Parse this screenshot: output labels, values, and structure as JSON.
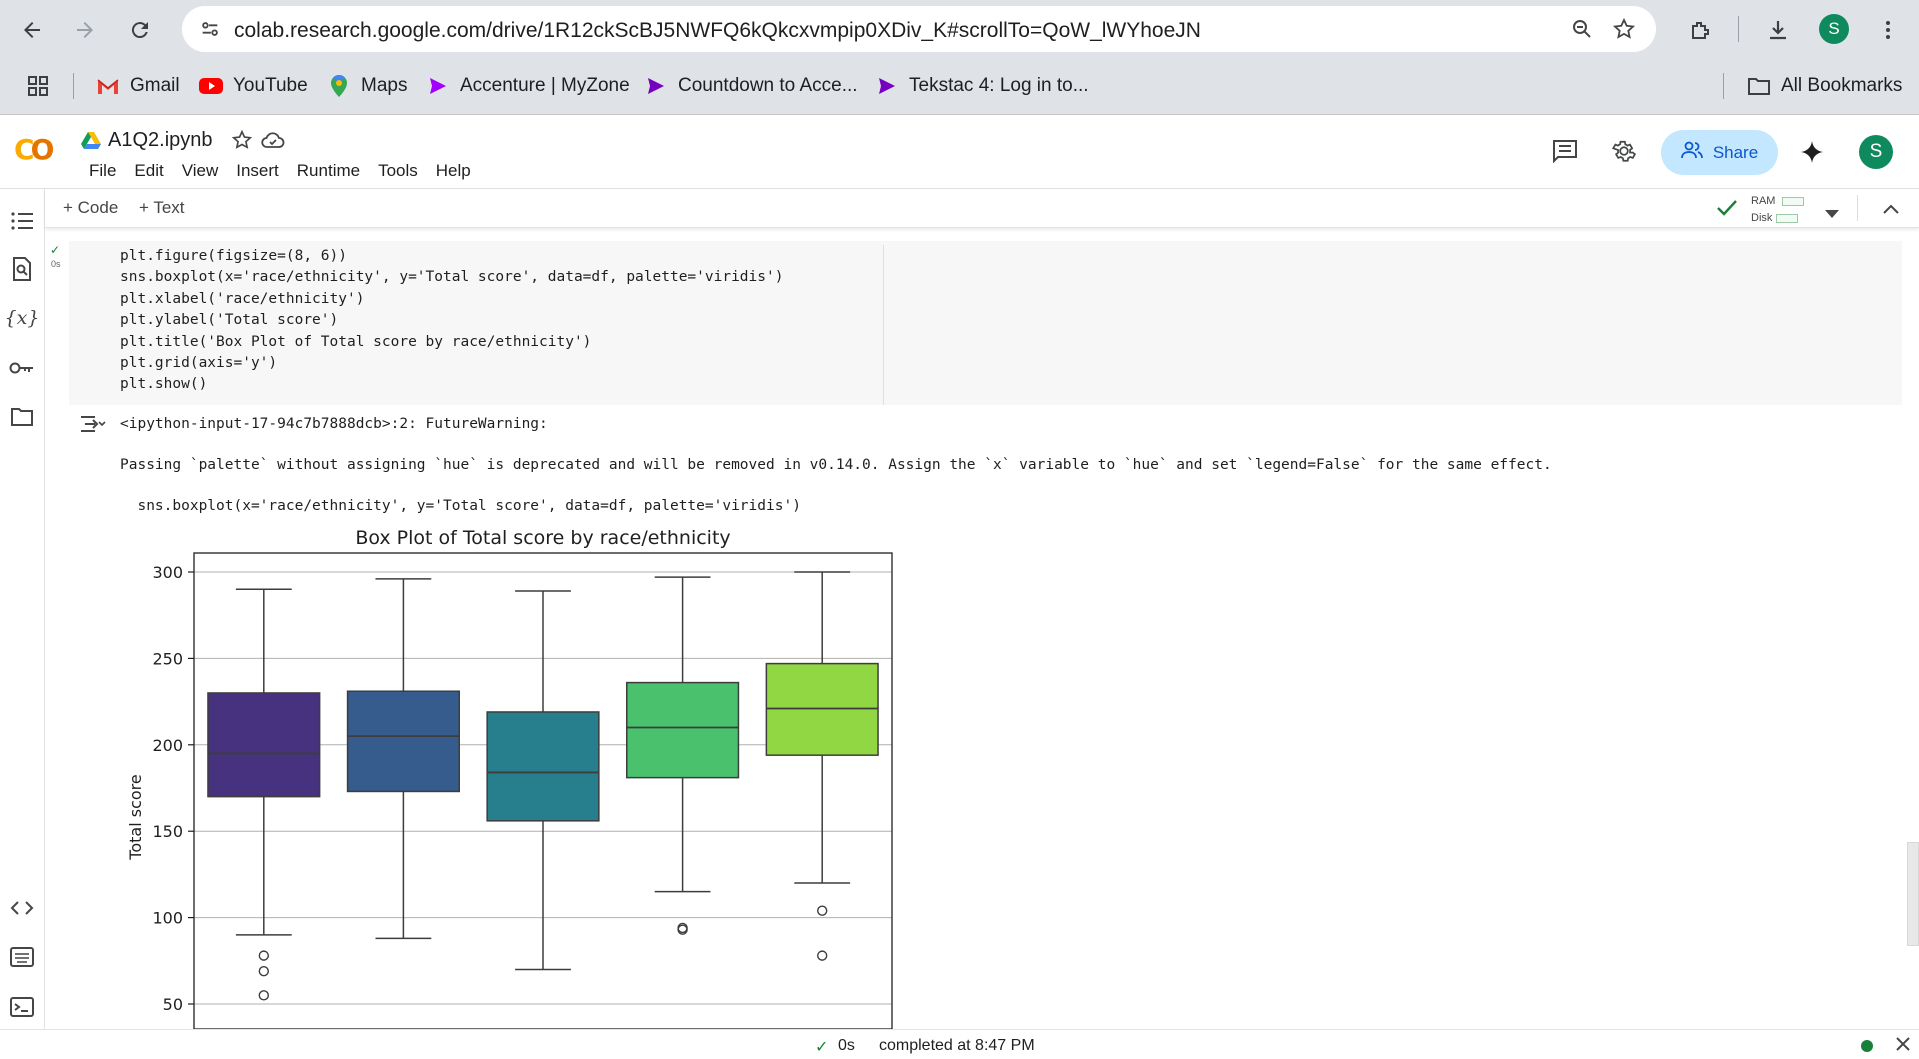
{
  "browser": {
    "url": "colab.research.google.com/drive/1R12ckScBJ5NWFQ6kQkcxvmpip0XDiv_K#scrollTo=QoW_lWYhoeJN",
    "profile_initial": "S",
    "bookmarks": [
      {
        "label": "Gmail",
        "icon": "gmail-icon"
      },
      {
        "label": "YouTube",
        "icon": "youtube-icon"
      },
      {
        "label": "Maps",
        "icon": "maps-icon"
      },
      {
        "label": "Accenture | MyZone",
        "icon": "accenture-icon"
      },
      {
        "label": "Countdown to Acce...",
        "icon": "accenture-icon"
      },
      {
        "label": "Tekstac 4: Log in to...",
        "icon": "accenture-icon"
      }
    ],
    "all_bookmarks": "All Bookmarks"
  },
  "colab": {
    "logo": "CO",
    "notebook_title": "A1Q2.ipynb",
    "menu": [
      "File",
      "Edit",
      "View",
      "Insert",
      "Runtime",
      "Tools",
      "Help"
    ],
    "share_label": "Share",
    "user_initial": "S",
    "toolbar": {
      "code": "+ Code",
      "text": "+ Text",
      "ram": "RAM",
      "disk": "Disk"
    }
  },
  "cell": {
    "exec_time": "0s",
    "code_lines": [
      "plt.figure(figsize=(8, 6))",
      "sns.boxplot(x='race/ethnicity', y='Total score', data=df, palette='viridis')",
      "plt.xlabel('race/ethnicity')",
      "plt.ylabel('Total score')",
      "plt.title('Box Plot of Total score by race/ethnicity')",
      "plt.grid(axis='y')",
      "plt.show()"
    ],
    "output": {
      "warning_source": "<ipython-input-17-94c7b7888dcb>:2: FutureWarning:",
      "warning_message": "Passing `palette` without assigning `hue` is deprecated and will be removed in v0.14.0. Assign the `x` variable to `hue` and set `legend=False` for the same effect.",
      "warning_code": "  sns.boxplot(x='race/ethnicity', y='Total score', data=df, palette='viridis')"
    }
  },
  "chart_data": {
    "type": "box",
    "title": "Box Plot of Total score by race/ethnicity",
    "ylabel": "Total score",
    "xlabel": "",
    "y_ticks": [
      50,
      100,
      150,
      200,
      250,
      300
    ],
    "ylim": [
      43,
      314
    ],
    "grid": "y",
    "boxes": [
      {
        "q1": 170,
        "median": 195,
        "q3": 230,
        "whisker_low": 90,
        "whisker_high": 290,
        "outliers": [
          78,
          69,
          55
        ],
        "color": "#46327e"
      },
      {
        "q1": 173,
        "median": 205,
        "q3": 231,
        "whisker_low": 88,
        "whisker_high": 296,
        "outliers": [],
        "color": "#365c8d"
      },
      {
        "q1": 156,
        "median": 184,
        "q3": 219,
        "whisker_low": 70,
        "whisker_high": 289,
        "outliers": [],
        "color": "#277f8e"
      },
      {
        "q1": 181,
        "median": 210,
        "q3": 236,
        "whisker_low": 115,
        "whisker_high": 297,
        "outliers": [
          93,
          94
        ],
        "color": "#4ac16d"
      },
      {
        "q1": 194,
        "median": 221,
        "q3": 247,
        "whisker_low": 120,
        "whisker_high": 300,
        "outliers": [
          104,
          78
        ],
        "color": "#90d743"
      }
    ]
  },
  "status": {
    "time": "0s",
    "message": "completed at 8:47 PM"
  }
}
